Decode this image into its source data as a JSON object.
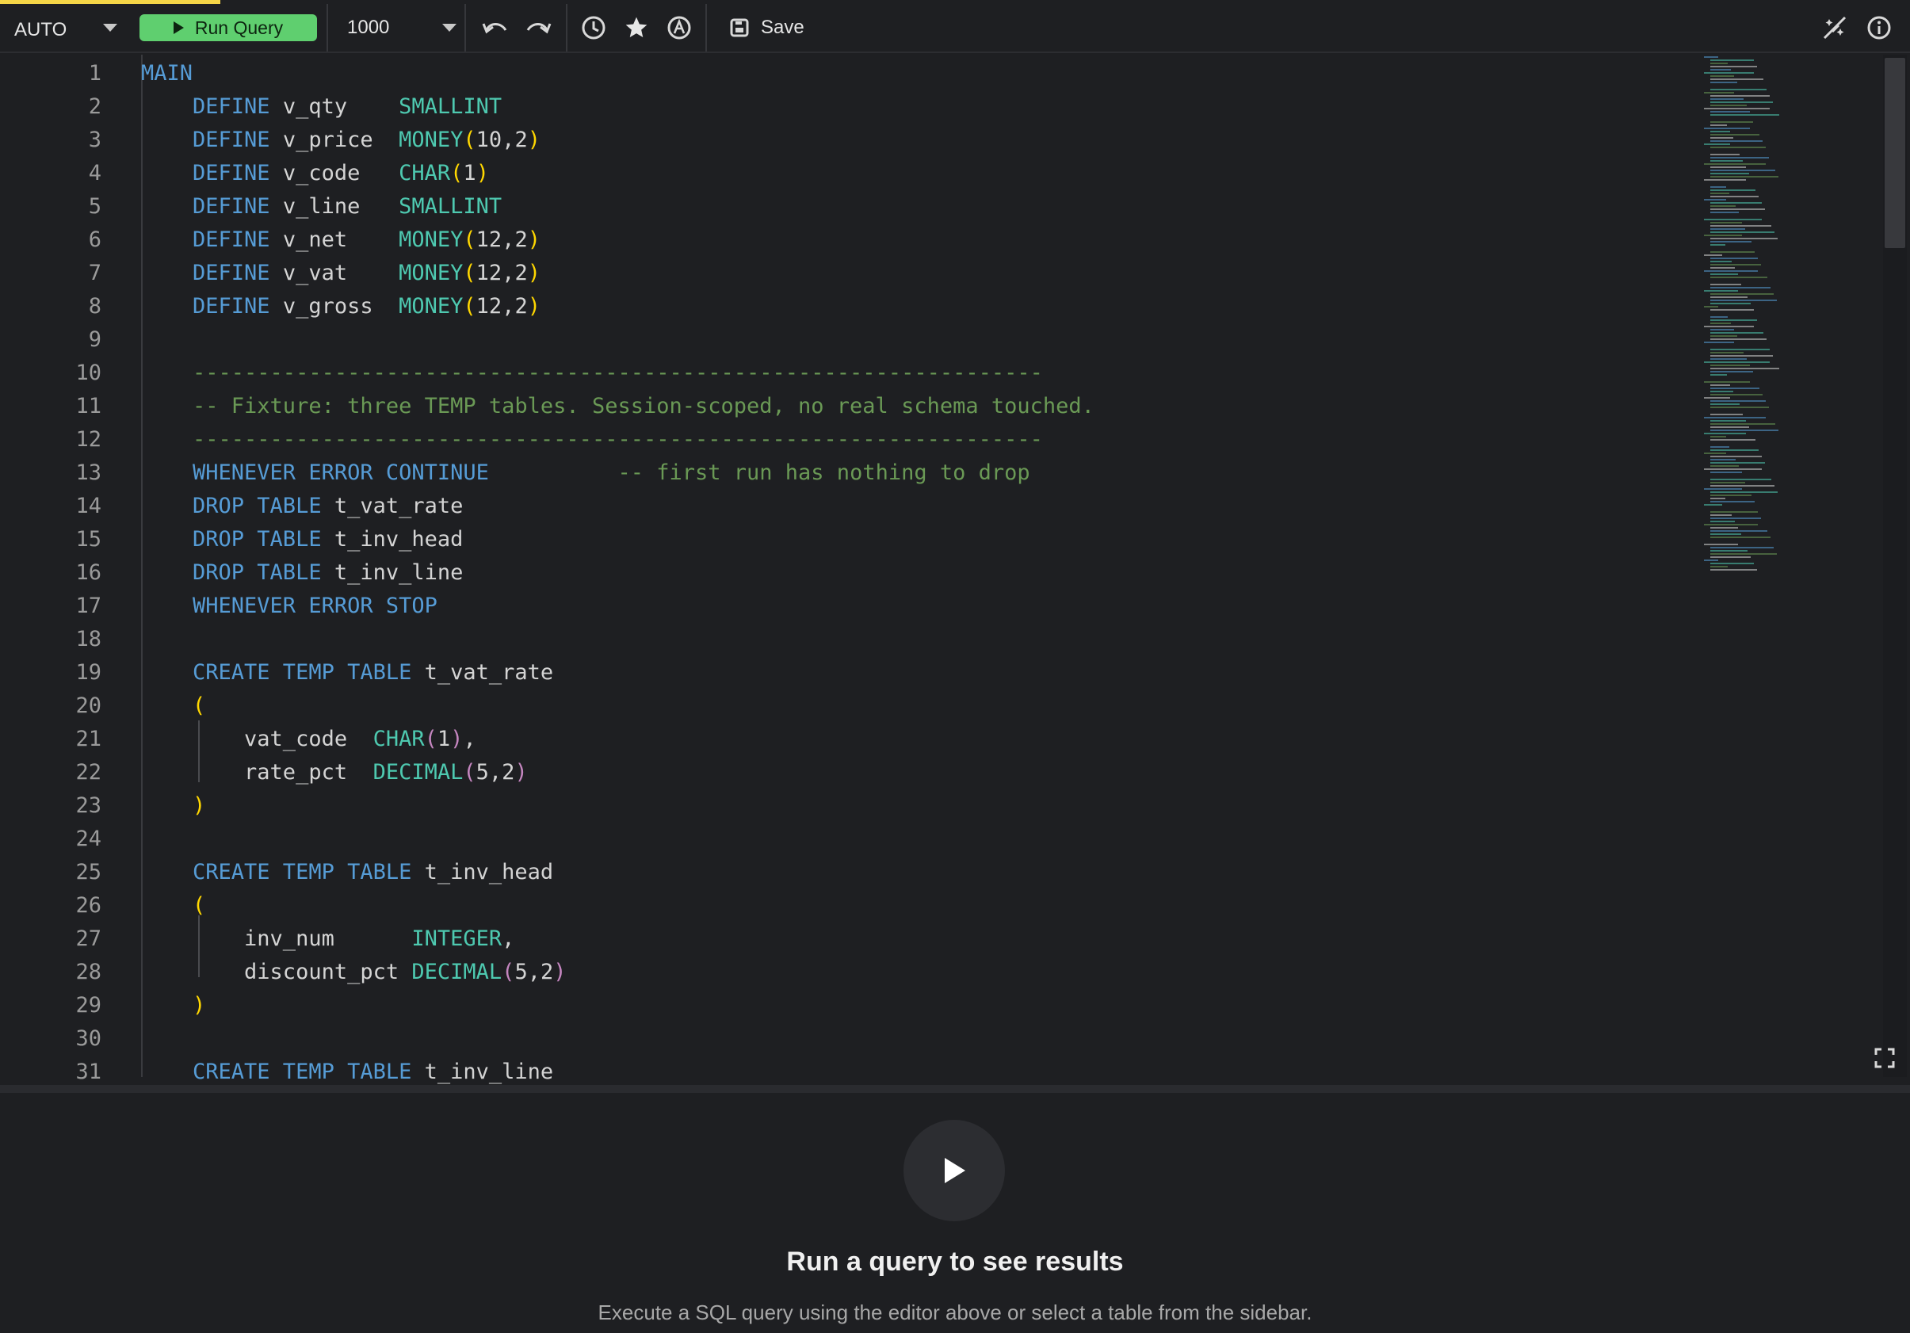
{
  "toolbar": {
    "mode": "AUTO",
    "run_label": "Run Query",
    "limit": "1000",
    "save_label": "Save",
    "accent_color": "#5fcf6f",
    "icons": [
      "undo-icon",
      "redo-icon",
      "history-icon",
      "star-icon",
      "format-icon",
      "disable-magic-icon",
      "info-icon"
    ]
  },
  "editor": {
    "lines": [
      {
        "n": "1",
        "t": [
          [
            "kw",
            "MAIN"
          ]
        ]
      },
      {
        "n": "2",
        "t": [
          [
            "kw",
            "    DEFINE "
          ],
          [
            "nm",
            "v_qty    "
          ],
          [
            "ty",
            "SMALLINT"
          ]
        ]
      },
      {
        "n": "3",
        "t": [
          [
            "kw",
            "    DEFINE "
          ],
          [
            "nm",
            "v_price  "
          ],
          [
            "ty",
            "MONEY"
          ],
          [
            "yl",
            "("
          ],
          [
            "nm",
            "10,2"
          ],
          [
            "yl",
            ")"
          ]
        ]
      },
      {
        "n": "4",
        "t": [
          [
            "kw",
            "    DEFINE "
          ],
          [
            "nm",
            "v_code   "
          ],
          [
            "ty",
            "CHAR"
          ],
          [
            "yl",
            "("
          ],
          [
            "nm",
            "1"
          ],
          [
            "yl",
            ")"
          ]
        ]
      },
      {
        "n": "5",
        "t": [
          [
            "kw",
            "    DEFINE "
          ],
          [
            "nm",
            "v_line   "
          ],
          [
            "ty",
            "SMALLINT"
          ]
        ]
      },
      {
        "n": "6",
        "t": [
          [
            "kw",
            "    DEFINE "
          ],
          [
            "nm",
            "v_net    "
          ],
          [
            "ty",
            "MONEY"
          ],
          [
            "yl",
            "("
          ],
          [
            "nm",
            "12,2"
          ],
          [
            "yl",
            ")"
          ]
        ]
      },
      {
        "n": "7",
        "t": [
          [
            "kw",
            "    DEFINE "
          ],
          [
            "nm",
            "v_vat    "
          ],
          [
            "ty",
            "MONEY"
          ],
          [
            "yl",
            "("
          ],
          [
            "nm",
            "12,2"
          ],
          [
            "yl",
            ")"
          ]
        ]
      },
      {
        "n": "8",
        "t": [
          [
            "kw",
            "    DEFINE "
          ],
          [
            "nm",
            "v_gross  "
          ],
          [
            "ty",
            "MONEY"
          ],
          [
            "yl",
            "("
          ],
          [
            "nm",
            "12,2"
          ],
          [
            "yl",
            ")"
          ]
        ]
      },
      {
        "n": "9",
        "t": []
      },
      {
        "n": "10",
        "t": [
          [
            "cm",
            "    ------------------------------------------------------------------"
          ]
        ]
      },
      {
        "n": "11",
        "t": [
          [
            "cm",
            "    -- Fixture: three TEMP tables. Session-scoped, no real schema touched."
          ]
        ]
      },
      {
        "n": "12",
        "t": [
          [
            "cm",
            "    ------------------------------------------------------------------"
          ]
        ]
      },
      {
        "n": "13",
        "t": [
          [
            "kw",
            "    WHENEVER ERROR CONTINUE"
          ],
          [
            "nm",
            "          "
          ],
          [
            "cm",
            "-- first run has nothing to drop"
          ]
        ]
      },
      {
        "n": "14",
        "t": [
          [
            "kw",
            "    DROP TABLE "
          ],
          [
            "nm",
            "t_vat_rate"
          ]
        ]
      },
      {
        "n": "15",
        "t": [
          [
            "kw",
            "    DROP TABLE "
          ],
          [
            "nm",
            "t_inv_head"
          ]
        ]
      },
      {
        "n": "16",
        "t": [
          [
            "kw",
            "    DROP TABLE "
          ],
          [
            "nm",
            "t_inv_line"
          ]
        ]
      },
      {
        "n": "17",
        "t": [
          [
            "kw",
            "    WHENEVER ERROR STOP"
          ]
        ]
      },
      {
        "n": "18",
        "t": []
      },
      {
        "n": "19",
        "t": [
          [
            "kw",
            "    CREATE TEMP TABLE "
          ],
          [
            "nm",
            "t_vat_rate"
          ]
        ]
      },
      {
        "n": "20",
        "t": [
          [
            "nm",
            "    "
          ],
          [
            "yl",
            "("
          ]
        ]
      },
      {
        "n": "21",
        "t": [
          [
            "nm",
            "        vat_code  "
          ],
          [
            "ty",
            "CHAR"
          ],
          [
            "pk",
            "("
          ],
          [
            "nm",
            "1"
          ],
          [
            "pk",
            ")"
          ],
          [
            "nm",
            ","
          ]
        ]
      },
      {
        "n": "22",
        "t": [
          [
            "nm",
            "        rate_pct  "
          ],
          [
            "ty",
            "DECIMAL"
          ],
          [
            "pk",
            "("
          ],
          [
            "nm",
            "5,2"
          ],
          [
            "pk",
            ")"
          ]
        ]
      },
      {
        "n": "23",
        "t": [
          [
            "nm",
            "    "
          ],
          [
            "yl",
            ")"
          ]
        ]
      },
      {
        "n": "24",
        "t": []
      },
      {
        "n": "25",
        "t": [
          [
            "kw",
            "    CREATE TEMP TABLE "
          ],
          [
            "nm",
            "t_inv_head"
          ]
        ]
      },
      {
        "n": "26",
        "t": [
          [
            "nm",
            "    "
          ],
          [
            "yl",
            "("
          ]
        ]
      },
      {
        "n": "27",
        "t": [
          [
            "nm",
            "        inv_num      "
          ],
          [
            "ty",
            "INTEGER"
          ],
          [
            "nm",
            ","
          ]
        ]
      },
      {
        "n": "28",
        "t": [
          [
            "nm",
            "        discount_pct "
          ],
          [
            "ty",
            "DECIMAL"
          ],
          [
            "pk",
            "("
          ],
          [
            "nm",
            "5,2"
          ],
          [
            "pk",
            ")"
          ]
        ]
      },
      {
        "n": "29",
        "t": [
          [
            "nm",
            "    "
          ],
          [
            "yl",
            ")"
          ]
        ]
      },
      {
        "n": "30",
        "t": []
      },
      {
        "n": "31",
        "t": [
          [
            "kw",
            "    CREATE TEMP TABLE "
          ],
          [
            "nm",
            "t_inv_line"
          ]
        ]
      }
    ]
  },
  "results": {
    "title": "Run a query to see results",
    "subtitle": "Execute a SQL query using the editor above or select a table from the sidebar."
  }
}
